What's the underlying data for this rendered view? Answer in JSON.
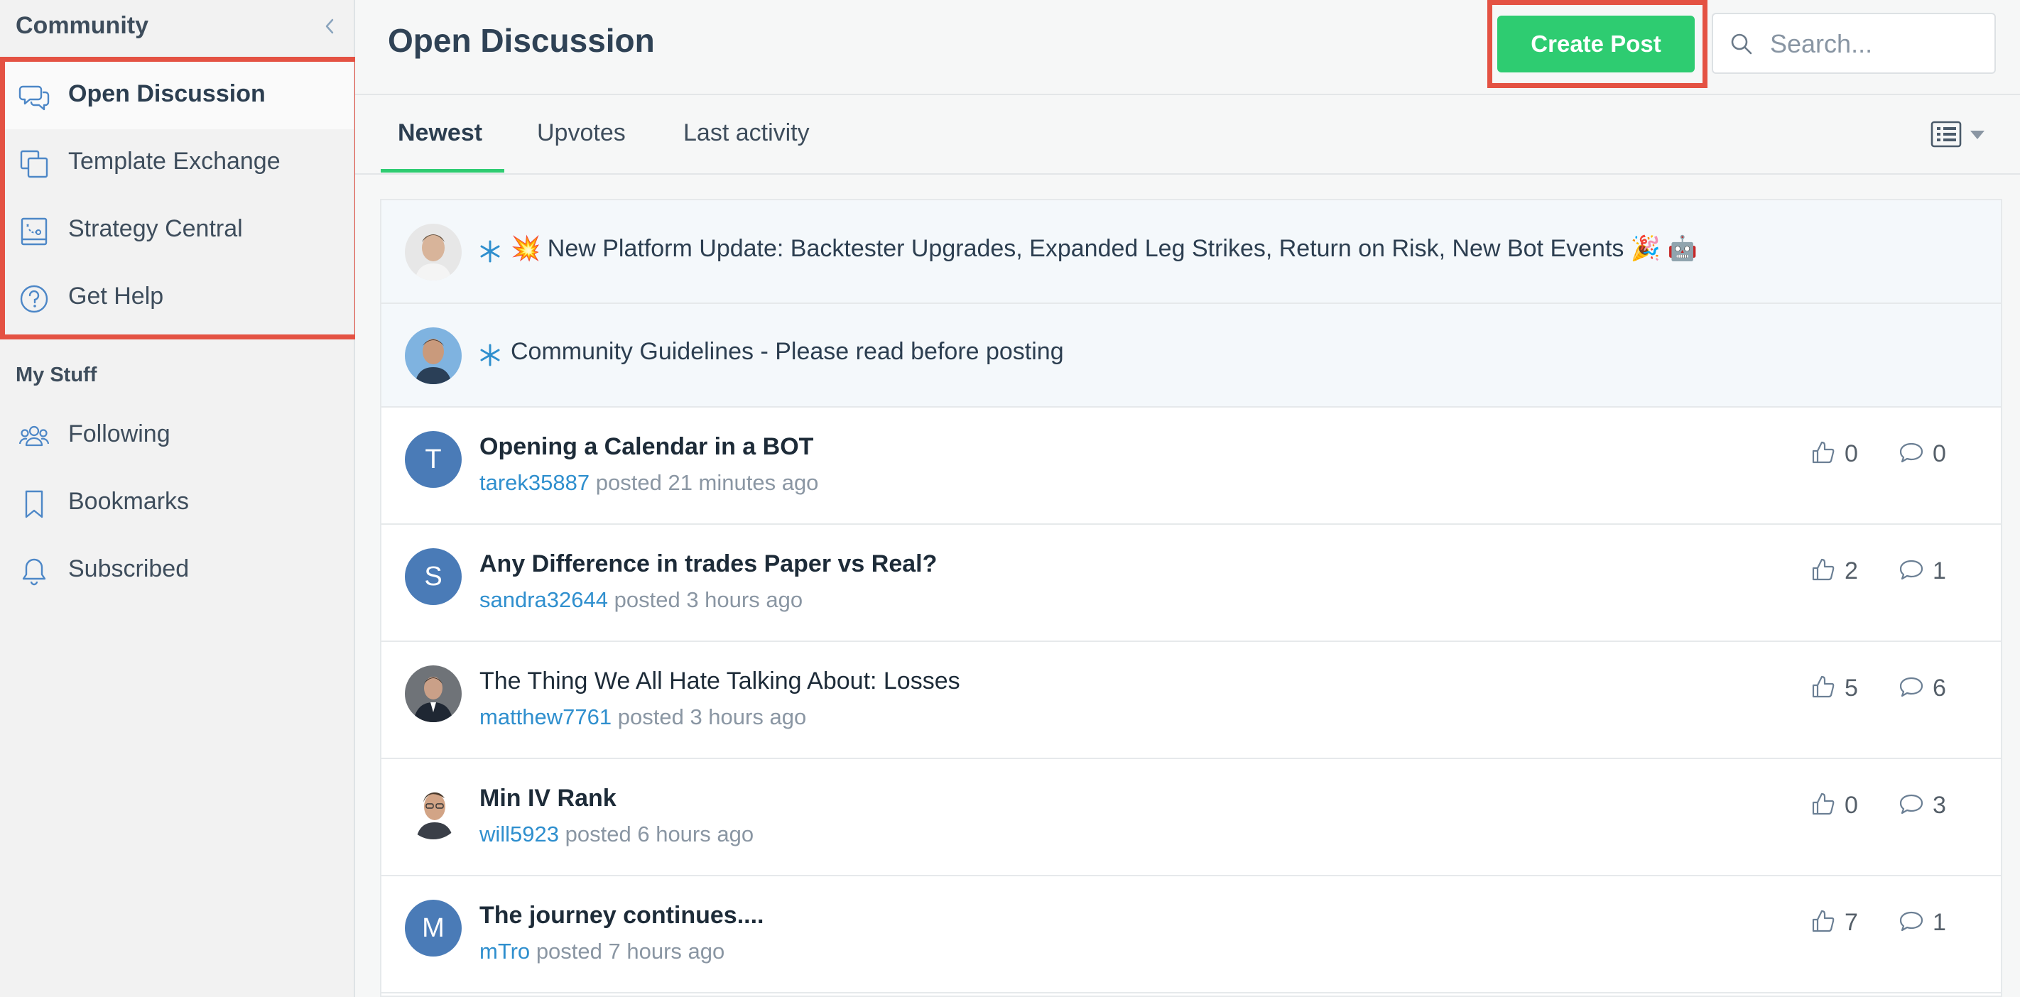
{
  "sidebar": {
    "title": "Community",
    "nav": [
      {
        "label": "Open Discussion",
        "icon": "chat-bubbles-icon",
        "active": true
      },
      {
        "label": "Template Exchange",
        "icon": "copy-icon"
      },
      {
        "label": "Strategy Central",
        "icon": "strategy-chart-icon"
      },
      {
        "label": "Get Help",
        "icon": "help-circle-icon"
      }
    ],
    "my_stuff_heading": "My Stuff",
    "my_stuff": [
      {
        "label": "Following",
        "icon": "users-icon"
      },
      {
        "label": "Bookmarks",
        "icon": "bookmark-icon"
      },
      {
        "label": "Subscribed",
        "icon": "bell-icon"
      }
    ]
  },
  "header": {
    "title": "Open Discussion",
    "create_label": "Create Post",
    "search_placeholder": "Search..."
  },
  "tabs": [
    {
      "label": "Newest",
      "active": true
    },
    {
      "label": "Upvotes"
    },
    {
      "label": "Last activity"
    }
  ],
  "pinned": [
    {
      "title": "💥 New Platform Update: Backtester Upgrades, Expanded Leg Strikes, Return on Risk, New Bot Events 🎉 🤖"
    },
    {
      "title": "Community Guidelines - Please read before posting"
    }
  ],
  "posts": [
    {
      "title": "Opening a Calendar in a BOT",
      "author": "tarek35887",
      "verb": "posted",
      "time": "21 minutes ago",
      "upvotes": "0",
      "comments": "0",
      "avatar_letter": "T"
    },
    {
      "title": "Any Difference in trades Paper vs Real?",
      "author": "sandra32644",
      "verb": "posted",
      "time": "3 hours ago",
      "upvotes": "2",
      "comments": "1",
      "avatar_letter": "S"
    },
    {
      "title": "The Thing We All Hate Talking About: Losses",
      "author": "matthew7761",
      "verb": "posted",
      "time": "3 hours ago",
      "upvotes": "5",
      "comments": "6"
    },
    {
      "title": "Min IV Rank",
      "author": "will5923",
      "verb": "posted",
      "time": "6 hours ago",
      "upvotes": "0",
      "comments": "3"
    },
    {
      "title": "The journey continues....",
      "author": "mTro",
      "verb": "posted",
      "time": "7 hours ago",
      "upvotes": "7",
      "comments": "1",
      "avatar_letter": "M"
    }
  ],
  "colors": {
    "accent_green": "#2ecc71",
    "highlight_red": "#e45243",
    "link_blue": "#2f8fce",
    "avatar_blue": "#4a7bb7"
  }
}
